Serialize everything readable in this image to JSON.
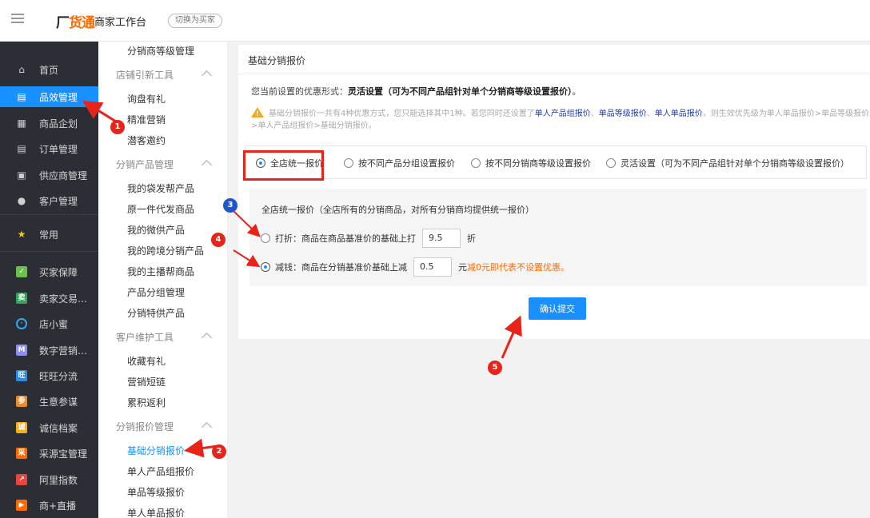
{
  "topbar": {
    "logo_prefix": "厂",
    "logo_main": "货通",
    "subtitle": "商家工作台",
    "switch_button": "切换为买家"
  },
  "sidebar": {
    "items": [
      {
        "label": "首页",
        "icon": "home-icon"
      },
      {
        "label": "品效管理",
        "icon": "report-icon",
        "active": true
      },
      {
        "label": "商品企划",
        "icon": "grid-icon"
      },
      {
        "label": "订单管理",
        "icon": "order-icon"
      },
      {
        "label": "供应商管理",
        "icon": "contact-card-icon"
      },
      {
        "label": "客户管理",
        "icon": "user-icon"
      },
      {
        "label": "常用",
        "icon": "star-icon"
      },
      {
        "label": "买家保障",
        "icon": "shield-app-icon"
      },
      {
        "label": "卖家交易…",
        "icon": "seller-app-icon"
      },
      {
        "label": "店小蜜",
        "icon": "bot-app-icon"
      },
      {
        "label": "数字营销…",
        "icon": "marketing-app-icon"
      },
      {
        "label": "旺旺分流",
        "icon": "wangwang-app-icon"
      },
      {
        "label": "生意参谋",
        "icon": "analytics-app-icon"
      },
      {
        "label": "诚信档案",
        "icon": "credit-app-icon"
      },
      {
        "label": "采源宝管理",
        "icon": "caiyuanbao-app-icon"
      },
      {
        "label": "阿里指数",
        "icon": "index-app-icon"
      },
      {
        "label": "商+直播",
        "icon": "live-app-icon"
      }
    ]
  },
  "submenu": {
    "top_item": "分销商等级管理",
    "groups": [
      {
        "title": "店铺引新工具",
        "items": [
          "询盘有礼",
          "精准营销",
          "潜客邀约"
        ]
      },
      {
        "title": "分销产品管理",
        "items": [
          "我的袋发帮产品",
          "原一件代发商品",
          "我的微供产品",
          "我的跨境分销产品",
          "我的主播帮商品",
          "产品分组管理",
          "分销特供产品"
        ]
      },
      {
        "title": "客户维护工具",
        "items": [
          "收藏有礼",
          "营销短链",
          "累积返利"
        ]
      },
      {
        "title": "分销报价管理",
        "items": [
          "基础分销报价",
          "单人产品组报价",
          "单品等级报价",
          "单人单品报价"
        ]
      }
    ]
  },
  "content": {
    "title": "基础分销报价",
    "current_prefix": "您当前设置的优惠形式：",
    "current_value": "灵活设置（可为不同产品组针对单个分销商等级设置报价）",
    "current_suffix": "。",
    "notice_text_1": "基础分销报价一共有4种优惠方式，您只能选择其中1种。若您同时还设置了",
    "notice_link_1": "单人产品组报价",
    "notice_sep_1": "、",
    "notice_link_2": "单品等级报价",
    "notice_sep_2": "、",
    "notice_link_3": "单人单品报价",
    "notice_text_2": "，则生效优先级为单人单品报价>单品等级报价>单人产品组报价>基础分销报价。",
    "options": [
      "全店统一报价",
      "按不同产品分组设置报价",
      "按不同分销商等级设置报价",
      "灵活设置（可为不同产品组针对单个分销商等级设置报价）"
    ],
    "selected_option": 0,
    "panel_title": "全店统一报价（全店所有的分销商品，对所有分销商均提供统一报价）",
    "discount_label": "打折：商品在商品基准价的基础上打",
    "discount_value": "9.5",
    "discount_unit": "折",
    "reduce_label": "减钱：商品在分销基准价基础上减",
    "reduce_value": "0.5",
    "reduce_unit": "元",
    "reduce_hint": "减0元即代表不设置优惠。",
    "selected_row": "reduce",
    "submit_label": "确认提交"
  },
  "annotations": {
    "badges": [
      "1",
      "2",
      "3",
      "4",
      "5"
    ],
    "colors": {
      "red": "#e8231a",
      "blue": "#2255cc"
    }
  },
  "colors": {
    "sidebar_bg": "#2b2e35",
    "accent": "#1890ff",
    "brand_orange": "#ff6a00"
  }
}
